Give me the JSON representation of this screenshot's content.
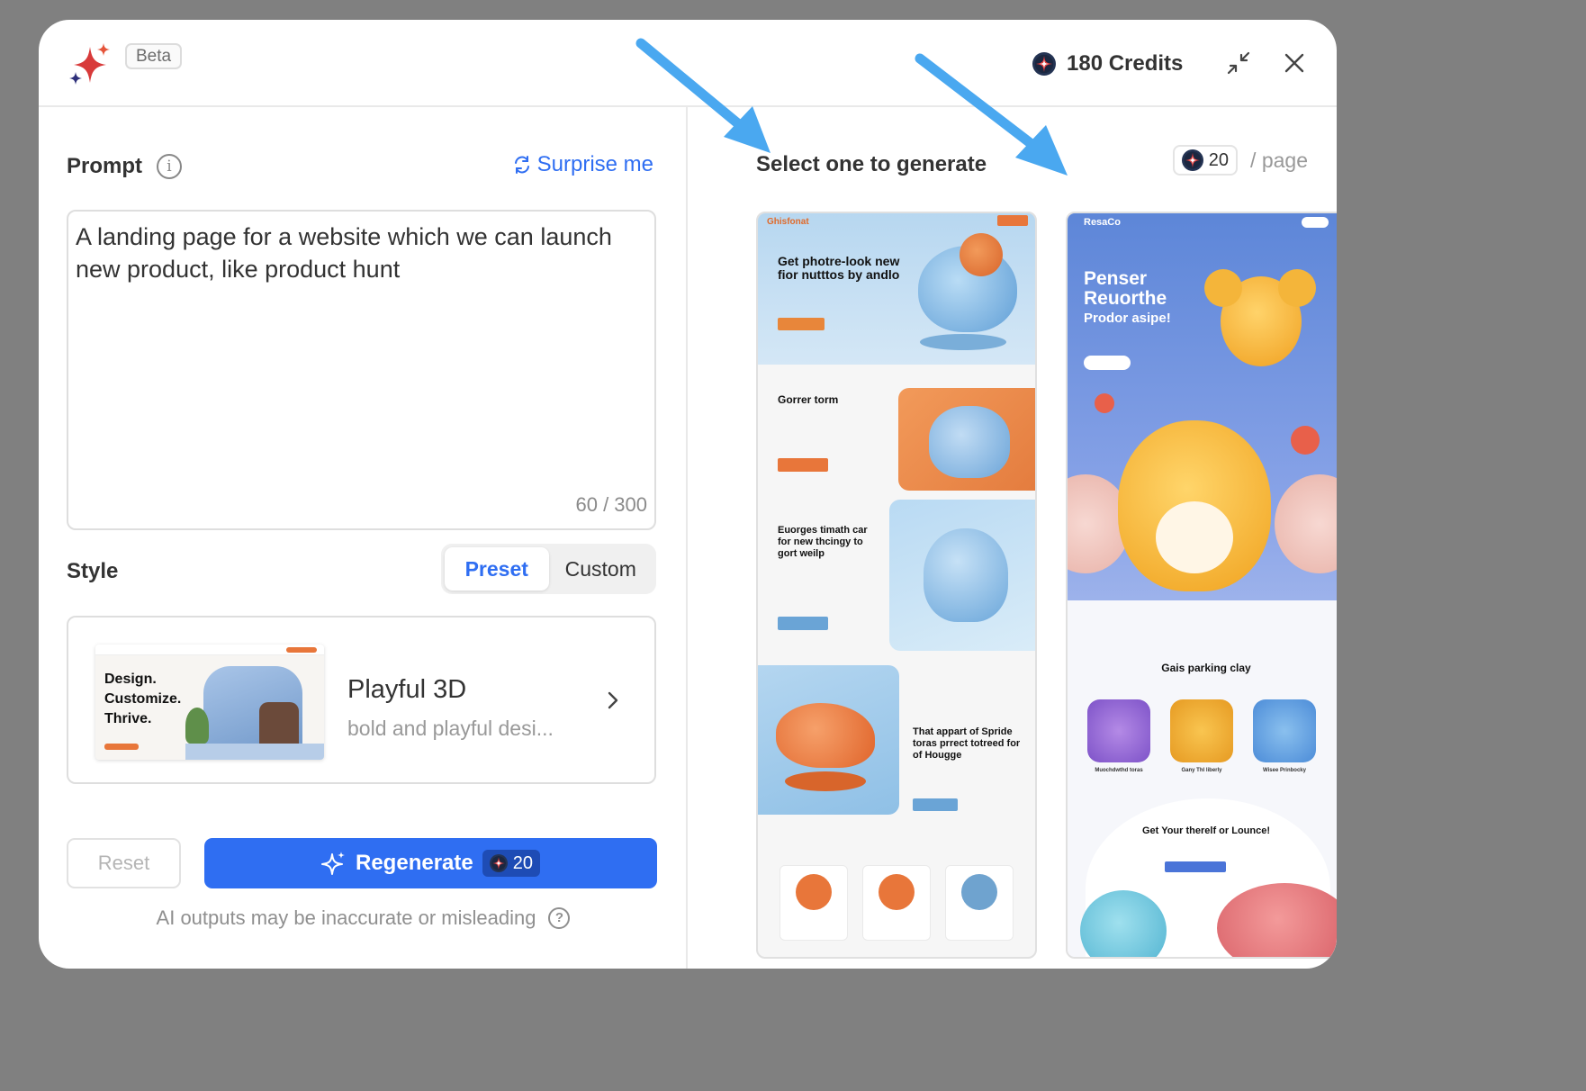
{
  "header": {
    "badge": "Beta",
    "credits_label": "180 Credits"
  },
  "prompt": {
    "label": "Prompt",
    "surprise_label": "Surprise me",
    "text": "A landing page for a website which we can launch new product, like product hunt",
    "counter": "60 / 300"
  },
  "style": {
    "label": "Style",
    "tabs": [
      "Preset",
      "Custom"
    ],
    "active_tab": "Preset",
    "preset": {
      "thumb_lines": [
        "Design.",
        "Customize.",
        "Thrive."
      ],
      "name": "Playful 3D",
      "description": "bold and playful desi..."
    }
  },
  "actions": {
    "reset_label": "Reset",
    "regenerate_label": "Regenerate",
    "regenerate_cost": "20"
  },
  "disclaimer": "AI outputs may be inaccurate or misleading",
  "results": {
    "title": "Select one to generate",
    "cost": "20",
    "per_page": "/ page",
    "previews": [
      {
        "brand": "Ghisfonat",
        "hero_title": "Get photre-look new fior nutttos by andlo",
        "sections": [
          "Gorrer torm",
          "Euorges timath car for new thcingy to gort weilp",
          "That appart of Spride toras prrect totreed for of Hougge"
        ]
      },
      {
        "brand": "ResaCo",
        "hero_title": "Penser Reuorthe",
        "hero_subtitle": "Prodor asipe!",
        "section_title": "Gais parking clay",
        "cards": [
          "Muochdwthd toras",
          "Gany Thl liberly",
          "Wisee Prinbocky"
        ],
        "cta_title": "Get Your therelf or Lounce!"
      }
    ]
  },
  "colors": {
    "accent": "#2f6ef2",
    "backdrop": "#808080",
    "annotation_arrow": "#4aa8f0"
  }
}
